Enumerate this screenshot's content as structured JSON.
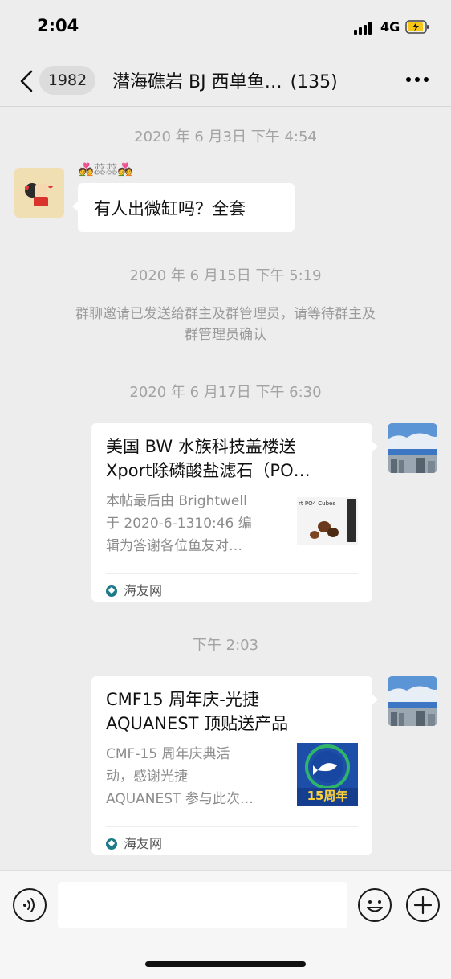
{
  "status_bar": {
    "time": "2:04",
    "network": "4G"
  },
  "header": {
    "back_count": "1982",
    "title": "潜海礁岩 BJ 西单鱼…",
    "member_count": "(135)"
  },
  "messages": {
    "ts1": "2020 年 6 月3日 下午 4:54",
    "sender_name": "💑蕊蕊💑",
    "bubble_text": "有人出微缸吗？全套",
    "ts2": "2020 年 6 月15日 下午 5:19",
    "system_line1": "群聊邀请已发送给群主及群管理员，请等待群主及",
    "system_line2": "群管理员确认",
    "ts3": "2020 年 6 月17日 下午 6:30",
    "card1": {
      "title_line1": "美国 BW 水族科技盖楼送",
      "title_line2": "Xport除磷酸盐滤石（PO…",
      "desc_line1": "本帖最后由 Brightwell",
      "desc_line2": "于 2020-6-1310:46 编",
      "desc_line3": "辑为答谢各位鱼友对…",
      "thumb_text": "rt PO4 Cubes",
      "source": "海友网"
    },
    "ts4": "下午 2:03",
    "card2": {
      "title_line1": "CMF15 周年庆-光捷",
      "title_line2": "AQUANEST 顶贴送产品",
      "desc_line1": "CMF-15 周年庆典活",
      "desc_line2": "动，感谢光捷",
      "desc_line3": "AQUANEST 参与此次…",
      "thumb_text": "15周年",
      "source": "海友网"
    }
  },
  "input_bar": {
    "placeholder": ""
  },
  "icons": {
    "back": "chevron-left-icon",
    "more": "more-dots-icon",
    "voice": "voice-icon",
    "emoji": "emoji-icon",
    "plus": "plus-icon"
  },
  "colors": {
    "background": "#ededed",
    "bubble": "#ffffff",
    "meta_text": "#a3a3a3"
  }
}
